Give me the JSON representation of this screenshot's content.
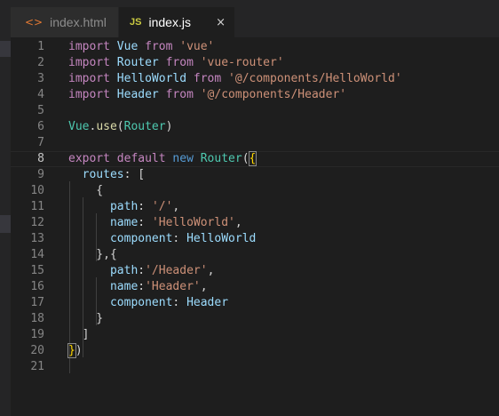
{
  "tabs": [
    {
      "label": "index.html",
      "icon": "<>",
      "icon_name": "html-file-icon"
    },
    {
      "label": "index.js",
      "icon": "JS",
      "icon_name": "js-file-icon",
      "close": "×"
    }
  ],
  "editor": {
    "current_line": 8,
    "lines": [
      {
        "n": "1",
        "tokens": [
          [
            "k",
            "import"
          ],
          [
            "p",
            " "
          ],
          [
            "v",
            "Vue"
          ],
          [
            "p",
            " "
          ],
          [
            "k",
            "from"
          ],
          [
            "p",
            " "
          ],
          [
            "s",
            "'vue'"
          ]
        ]
      },
      {
        "n": "2",
        "tokens": [
          [
            "k",
            "import"
          ],
          [
            "p",
            " "
          ],
          [
            "v",
            "Router"
          ],
          [
            "p",
            " "
          ],
          [
            "k",
            "from"
          ],
          [
            "p",
            " "
          ],
          [
            "s",
            "'vue-router'"
          ]
        ]
      },
      {
        "n": "3",
        "tokens": [
          [
            "k",
            "import"
          ],
          [
            "p",
            " "
          ],
          [
            "v",
            "HelloWorld"
          ],
          [
            "p",
            " "
          ],
          [
            "k",
            "from"
          ],
          [
            "p",
            " "
          ],
          [
            "s",
            "'@/components/HelloWorld'"
          ]
        ]
      },
      {
        "n": "4",
        "tokens": [
          [
            "k",
            "import"
          ],
          [
            "p",
            " "
          ],
          [
            "v",
            "Header"
          ],
          [
            "p",
            " "
          ],
          [
            "k",
            "from"
          ],
          [
            "p",
            " "
          ],
          [
            "s",
            "'@/components/Header'"
          ]
        ]
      },
      {
        "n": "5",
        "tokens": []
      },
      {
        "n": "6",
        "tokens": [
          [
            "c",
            "Vue"
          ],
          [
            "p",
            "."
          ],
          [
            "f",
            "use"
          ],
          [
            "p",
            "("
          ],
          [
            "c",
            "Router"
          ],
          [
            "p",
            ")"
          ]
        ]
      },
      {
        "n": "7",
        "tokens": []
      },
      {
        "n": "8",
        "tokens": [
          [
            "k",
            "export"
          ],
          [
            "p",
            " "
          ],
          [
            "k",
            "default"
          ],
          [
            "p",
            " "
          ],
          [
            "b",
            "new"
          ],
          [
            "p",
            " "
          ],
          [
            "c",
            "Router"
          ],
          [
            "p",
            "("
          ],
          [
            "x",
            "{"
          ]
        ]
      },
      {
        "n": "9",
        "tokens": [
          [
            "p",
            "  "
          ],
          [
            "v",
            "routes"
          ],
          [
            "p",
            ": ["
          ]
        ]
      },
      {
        "n": "10",
        "tokens": [
          [
            "p",
            "    {"
          ]
        ]
      },
      {
        "n": "11",
        "tokens": [
          [
            "p",
            "      "
          ],
          [
            "v",
            "path"
          ],
          [
            "p",
            ": "
          ],
          [
            "s",
            "'/'"
          ],
          [
            "p",
            ","
          ]
        ]
      },
      {
        "n": "12",
        "tokens": [
          [
            "p",
            "      "
          ],
          [
            "v",
            "name"
          ],
          [
            "p",
            ": "
          ],
          [
            "s",
            "'HelloWorld'"
          ],
          [
            "p",
            ","
          ]
        ]
      },
      {
        "n": "13",
        "tokens": [
          [
            "p",
            "      "
          ],
          [
            "v",
            "component"
          ],
          [
            "p",
            ": "
          ],
          [
            "v",
            "HelloWorld"
          ]
        ]
      },
      {
        "n": "14",
        "tokens": [
          [
            "p",
            "    },{"
          ]
        ]
      },
      {
        "n": "15",
        "tokens": [
          [
            "p",
            "      "
          ],
          [
            "v",
            "path"
          ],
          [
            "p",
            ":"
          ],
          [
            "s",
            "'/Header'"
          ],
          [
            "p",
            ","
          ]
        ]
      },
      {
        "n": "16",
        "tokens": [
          [
            "p",
            "      "
          ],
          [
            "v",
            "name"
          ],
          [
            "p",
            ":"
          ],
          [
            "s",
            "'Header'"
          ],
          [
            "p",
            ","
          ]
        ]
      },
      {
        "n": "17",
        "tokens": [
          [
            "p",
            "      "
          ],
          [
            "v",
            "component"
          ],
          [
            "p",
            ": "
          ],
          [
            "v",
            "Header"
          ]
        ]
      },
      {
        "n": "18",
        "tokens": [
          [
            "p",
            "    }"
          ]
        ]
      },
      {
        "n": "19",
        "tokens": [
          [
            "p",
            "  ]"
          ]
        ]
      },
      {
        "n": "20",
        "tokens": [
          [
            "x",
            "}"
          ],
          [
            "p",
            ")"
          ]
        ]
      },
      {
        "n": "21",
        "tokens": []
      }
    ]
  },
  "colors": {
    "keyword": "#c586c0",
    "storage": "#569cd6",
    "variable": "#9cdcfe",
    "string": "#ce9178",
    "function": "#dcdcaa",
    "class": "#4ec9b0",
    "punctuation": "#d4d4d4",
    "line_number": "#858585",
    "background": "#1e1e1e"
  }
}
